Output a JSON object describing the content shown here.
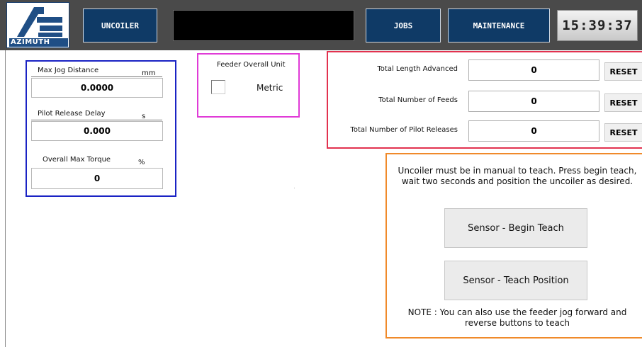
{
  "header": {
    "logo_text": "AZIMUTH",
    "uncoiler_label": "UNCOILER",
    "jobs_label": "JOBS",
    "maintenance_label": "MAINTENANCE",
    "clock": "15:39:37"
  },
  "jog_panel": {
    "max_jog_distance": {
      "label": "Max Jog Distance",
      "unit": "mm",
      "value": "0.0000"
    },
    "pilot_release_delay": {
      "label": "Pilot Release Delay",
      "unit": "s",
      "value": "0.000"
    },
    "overall_max_torque": {
      "label": "Overall Max Torque",
      "unit": "%",
      "value": "0"
    }
  },
  "unit_panel": {
    "title": "Feeder Overall Unit",
    "option_label": "Metric",
    "checked": false
  },
  "counters": {
    "reset_label": "RESET",
    "items": [
      {
        "label": "Total Length Advanced",
        "value": "0"
      },
      {
        "label": "Total Number of Feeds",
        "value": "0"
      },
      {
        "label": "Total Number of Pilot Releases",
        "value": "0"
      }
    ]
  },
  "teach_panel": {
    "instructions": "Uncoiler must be in manual to teach. Press begin teach, wait two seconds and position the uncoiler as desired.",
    "begin_button": "Sensor - Begin Teach",
    "position_button": "Sensor - Teach Position",
    "note": "NOTE : You can also use the feeder jog forward and reverse buttons to teach"
  },
  "colors": {
    "topbar": "#4a4a4a",
    "nav_button": "#0f3a66",
    "jog_border": "#1a23c4",
    "unit_border": "#e03bd7",
    "counter_border": "#e2324f",
    "teach_border": "#f08a2a"
  }
}
